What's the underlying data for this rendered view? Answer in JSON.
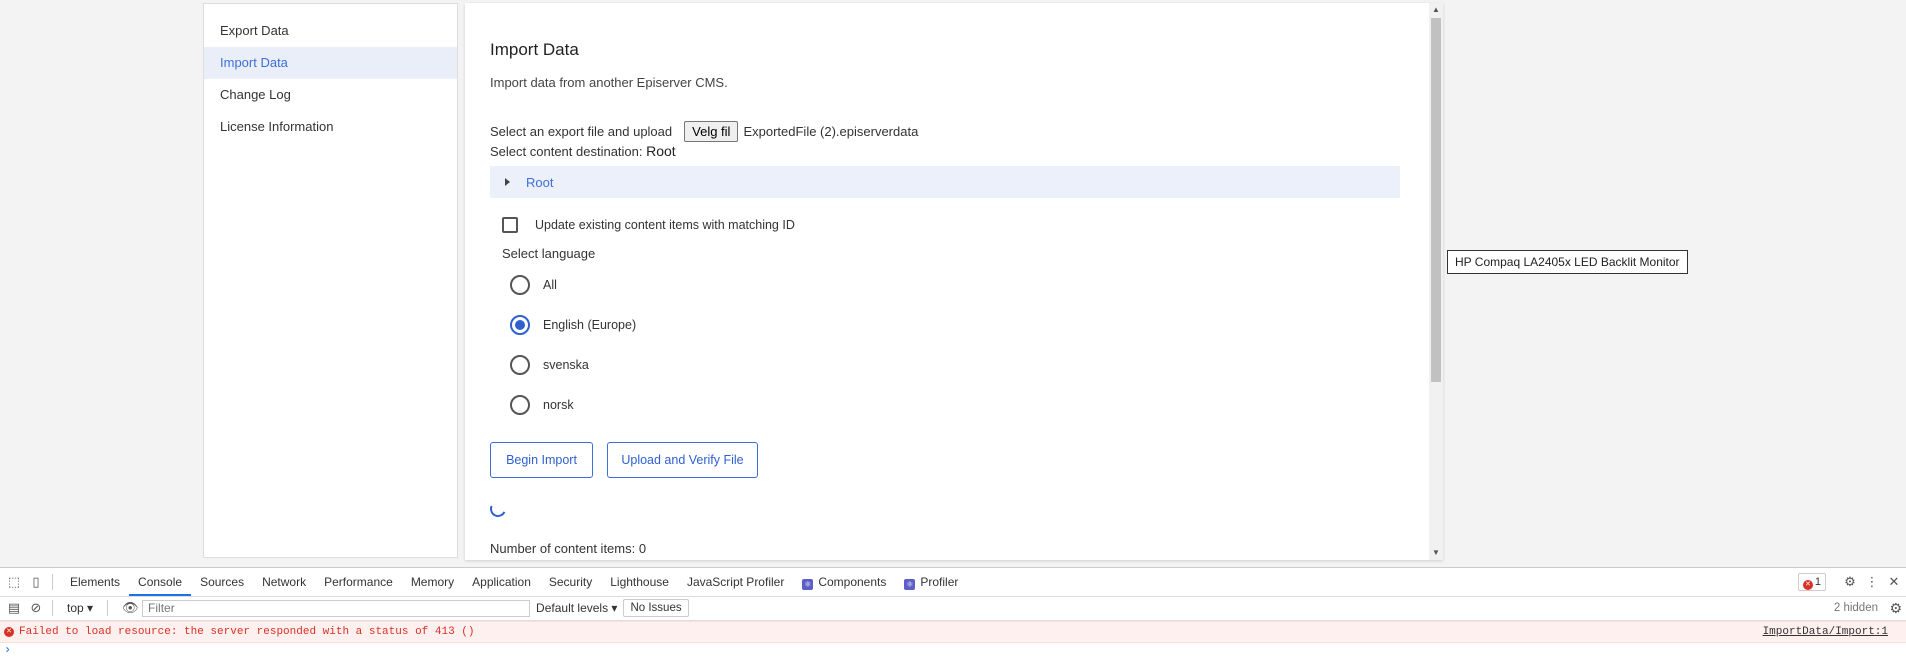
{
  "nav": {
    "items": [
      {
        "label": "Export Data"
      },
      {
        "label": "Import Data"
      },
      {
        "label": "Change Log"
      },
      {
        "label": "License Information"
      }
    ]
  },
  "import": {
    "title": "Import Data",
    "description": "Import data from another Episerver CMS.",
    "upload_label": "Select an export file and upload",
    "file_button": "Velg fil",
    "file_name": "ExportedFile (2).episerverdata",
    "dest_label": "Select content destination:",
    "dest_value": "Root",
    "tree_root": "Root",
    "update_label": "Update existing content items with matching ID",
    "language_label": "Select language",
    "languages": [
      {
        "label": "All",
        "checked": false
      },
      {
        "label": "English (Europe)",
        "checked": true
      },
      {
        "label": "svenska",
        "checked": false
      },
      {
        "label": "norsk",
        "checked": false
      }
    ],
    "begin_button": "Begin Import",
    "verify_button": "Upload and Verify File",
    "count_text": "Number of content items: 0"
  },
  "tooltip": "HP Compaq LA2405x LED Backlit Monitor",
  "devtools": {
    "tabs": [
      "Elements",
      "Console",
      "Sources",
      "Network",
      "Performance",
      "Memory",
      "Application",
      "Security",
      "Lighthouse",
      "JavaScript Profiler",
      "Components",
      "Profiler"
    ],
    "active_tab": "Console",
    "error_count": "1",
    "context": "top",
    "filter_placeholder": "Filter",
    "levels": "Default levels",
    "issues": "No Issues",
    "hidden": "2 hidden",
    "error_message": "Failed to load resource: the server responded with a status of 413 ()",
    "error_source": "ImportData/Import:1"
  }
}
